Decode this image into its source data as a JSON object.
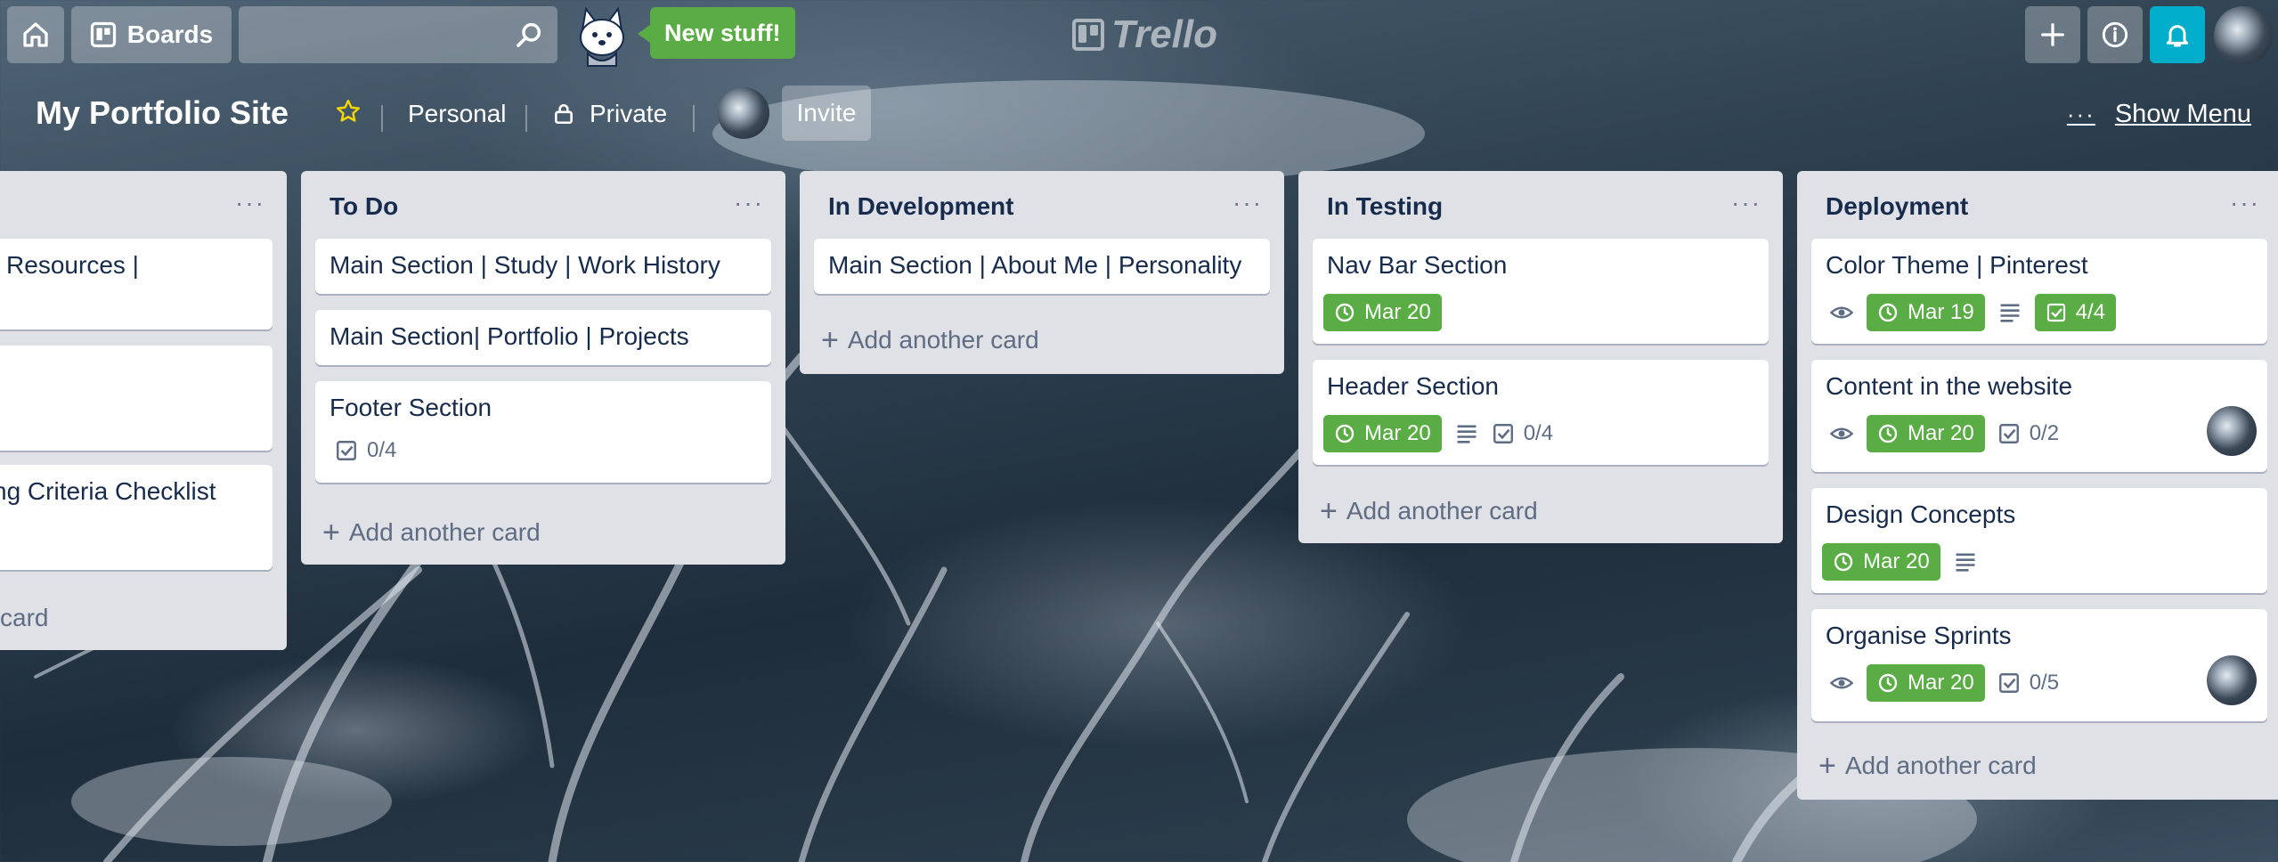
{
  "header": {
    "boards_label": "Boards",
    "new_stuff_label": "New stuff!",
    "logo_text": "Trello"
  },
  "board": {
    "title": "My Portfolio Site",
    "team_label": "Personal",
    "visibility_label": "Private",
    "invite_label": "Invite",
    "show_menu_label": "Show Menu"
  },
  "lists": [
    {
      "title": "",
      "cards": [
        {
          "title": "| Resources |"
        },
        {
          "title": ""
        },
        {
          "title": "ng Criteria Checklist"
        }
      ],
      "add_card_label": "card"
    },
    {
      "title": "To Do",
      "cards": [
        {
          "title": "Main Section | Study | Work History"
        },
        {
          "title": "Main Section| Portfolio | Projects"
        },
        {
          "title": "Footer Section",
          "checklist": "0/4"
        }
      ],
      "add_card_label": "Add another card"
    },
    {
      "title": "In Development",
      "cards": [
        {
          "title": "Main Section | About Me | Personality"
        }
      ],
      "add_card_label": "Add another card"
    },
    {
      "title": "In Testing",
      "cards": [
        {
          "title": "Nav Bar Section",
          "due": "Mar 20"
        },
        {
          "title": "Header Section",
          "due": "Mar 20",
          "checklist": "0/4"
        }
      ],
      "add_card_label": "Add another card"
    },
    {
      "title": "Deployment",
      "cards": [
        {
          "title": "Color Theme | Pinterest",
          "due": "Mar 19",
          "checklist": "4/4"
        },
        {
          "title": "Content in the website",
          "due": "Mar 20",
          "checklist": "0/2"
        },
        {
          "title": "Design Concepts",
          "due": "Mar 20"
        },
        {
          "title": "Organise Sprints",
          "due": "Mar 20",
          "checklist": "0/5"
        }
      ],
      "add_card_label": "Add another card"
    }
  ],
  "colors": {
    "due_badge": "#5aac44",
    "notification_button": "#00aecc",
    "list_background": "#dfe1e6",
    "star": "#f2d600"
  },
  "icons": [
    "home-icon",
    "boards-icon",
    "search-icon",
    "star-icon",
    "lock-icon",
    "plus-icon",
    "info-icon",
    "bell-icon",
    "clock-icon",
    "checklist-icon",
    "description-icon",
    "eye-icon"
  ]
}
